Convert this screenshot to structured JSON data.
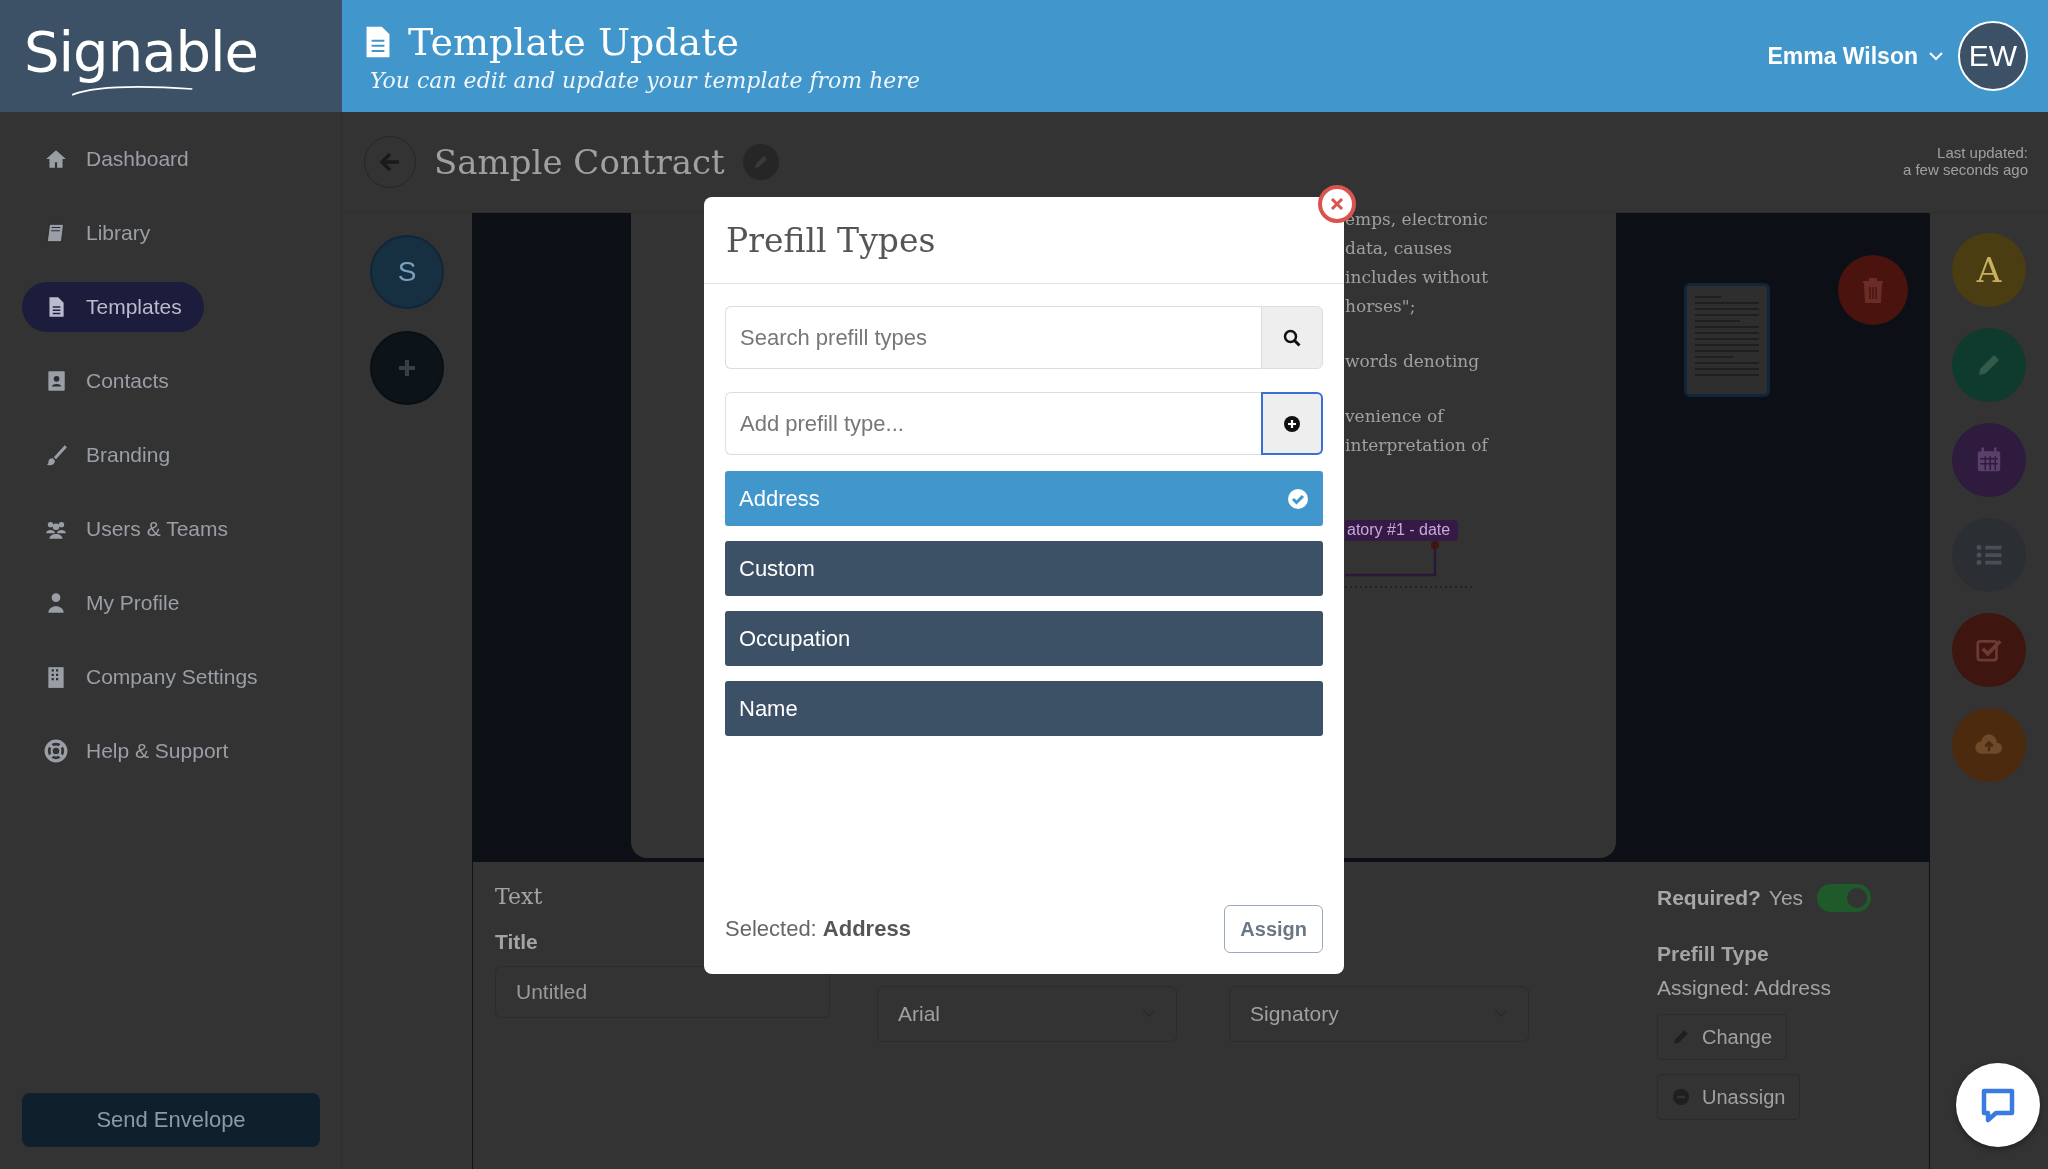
{
  "header": {
    "logo": "Signable",
    "title": "Template Update",
    "subtitle": "You can edit and update your template from here",
    "user_name": "Emma Wilson",
    "avatar_initials": "EW"
  },
  "sidebar": {
    "items": [
      {
        "label": "Dashboard",
        "kind": "home",
        "selected": false
      },
      {
        "label": "Library",
        "kind": "book",
        "selected": false
      },
      {
        "label": "Templates",
        "kind": "file",
        "selected": true
      },
      {
        "label": "Contacts",
        "kind": "contact",
        "selected": false
      },
      {
        "label": "Branding",
        "kind": "brush",
        "selected": false
      },
      {
        "label": "Users & Teams",
        "kind": "users",
        "selected": false
      },
      {
        "label": "My Profile",
        "kind": "user",
        "selected": false
      },
      {
        "label": "Company Settings",
        "kind": "building",
        "selected": false
      },
      {
        "label": "Help & Support",
        "kind": "lifebuoy",
        "selected": false
      }
    ],
    "send_button": "Send Envelope"
  },
  "toolbar": {
    "title": "Sample Contract",
    "last_updated_label": "Last updated:",
    "last_updated_value": "a few seconds ago"
  },
  "signers": [
    {
      "initial": "S"
    }
  ],
  "document": {
    "paragraphs": [
      [
        "emps, electronic",
        "data, causes",
        "includes without",
        "horses\";"
      ],
      [
        "words denoting"
      ],
      [
        "venience of",
        "interpretation of"
      ]
    ],
    "field_tag": "atory #1 - date"
  },
  "tools": [
    {
      "kind": "text",
      "label": "A",
      "color": "#4a3d12"
    },
    {
      "kind": "pencil",
      "color": "#0f3a2e"
    },
    {
      "kind": "calendar",
      "color": "#2e1b3d"
    },
    {
      "kind": "list",
      "color": "#2b2e33"
    },
    {
      "kind": "checkbox",
      "color": "#3e150f"
    },
    {
      "kind": "upload",
      "color": "#4b2a0d"
    }
  ],
  "properties": {
    "heading": "Text",
    "title_label": "Title",
    "title_placeholder": "Untitled",
    "font": "Arial",
    "signer": "Signatory",
    "required_label": "Required?",
    "required_value": "Yes",
    "required_on": true,
    "prefill_label": "Prefill Type",
    "prefill_assigned": "Assigned: Address",
    "change_button": "Change",
    "unassign_button": "Unassign"
  },
  "modal": {
    "title": "Prefill Types",
    "search_placeholder": "Search prefill types",
    "add_placeholder": "Add prefill type...",
    "items": [
      {
        "label": "Address",
        "selected": true
      },
      {
        "label": "Custom",
        "selected": false
      },
      {
        "label": "Occupation",
        "selected": false
      },
      {
        "label": "Name",
        "selected": false
      }
    ],
    "selected_text": "Selected: **Address**",
    "assign_button": "Assign"
  }
}
